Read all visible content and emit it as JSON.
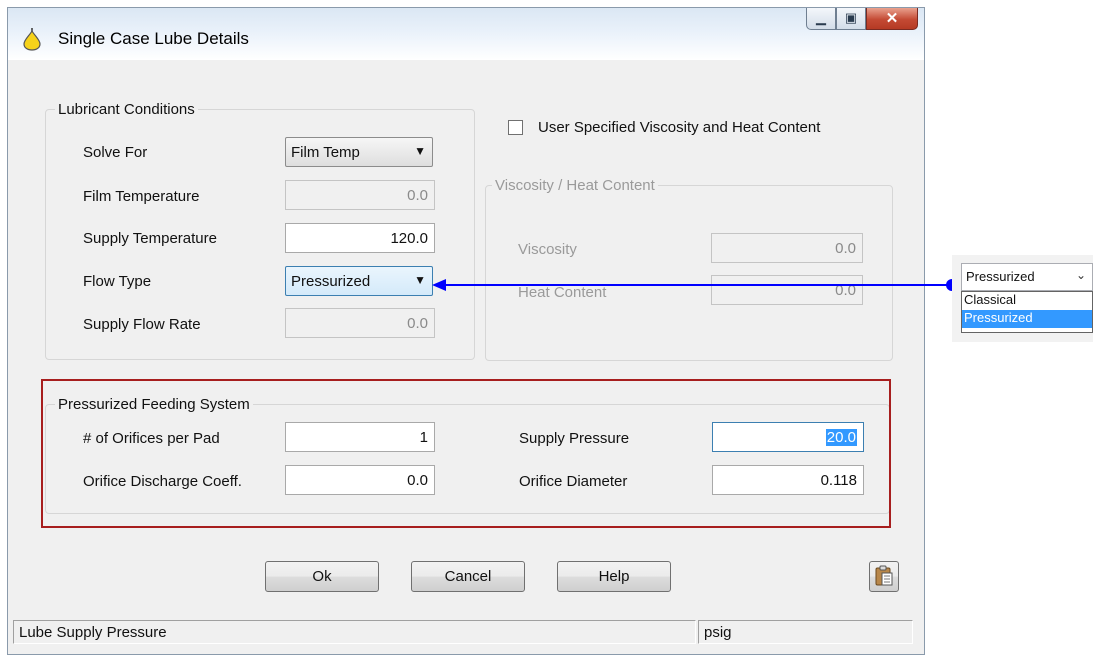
{
  "window": {
    "title": "Single Case Lube Details"
  },
  "lubricant": {
    "legend": "Lubricant Conditions",
    "solve_for_label": "Solve For",
    "solve_for_value": "Film Temp",
    "film_temp_label": "Film Temperature",
    "film_temp_value": "0.0",
    "supply_temp_label": "Supply Temperature",
    "supply_temp_value": "120.0",
    "flow_type_label": "Flow Type",
    "flow_type_value": "Pressurized",
    "supply_flow_label": "Supply Flow Rate",
    "supply_flow_value": "0.0"
  },
  "user_specified": {
    "label": "User Specified Viscosity and Heat Content",
    "checked": false
  },
  "viscosity": {
    "legend": "Viscosity / Heat Content",
    "viscosity_label": "Viscosity",
    "viscosity_value": "0.0",
    "heat_label": "Heat Content",
    "heat_value": "0.0"
  },
  "pressurized": {
    "legend": "Pressurized Feeding System",
    "orifices_label": "# of Orifices per Pad",
    "orifices_value": "1",
    "discharge_label": "Orifice Discharge Coeff.",
    "discharge_value": "0.0",
    "supply_pressure_label": "Supply Pressure",
    "supply_pressure_value": "20.0",
    "orifice_diameter_label": "Orifice Diameter",
    "orifice_diameter_value": "0.118"
  },
  "buttons": {
    "ok": "Ok",
    "cancel": "Cancel",
    "help": "Help"
  },
  "status": {
    "message": "Lube Supply Pressure",
    "units": "psig"
  },
  "dropdown_popup": {
    "selected": "Pressurized",
    "options": [
      "Classical",
      "Pressurized"
    ]
  },
  "colors": {
    "highlight": "#3399ff",
    "annotation_box": "#a71e1e",
    "arrow": "#0000ff"
  },
  "icons": [
    "oil-drop-icon",
    "minimize-icon",
    "maximize-icon",
    "close-icon",
    "paste-icon",
    "chevron-down-icon"
  ]
}
